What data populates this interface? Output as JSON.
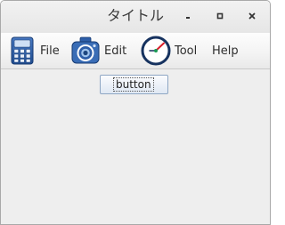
{
  "window": {
    "title": "タイトル"
  },
  "window_controls": {
    "minimize_icon": "minimize-icon",
    "maximize_icon": "maximize-icon",
    "close_icon": "close-icon"
  },
  "menubar": {
    "items": [
      {
        "label": "File",
        "icon": "calculator-icon"
      },
      {
        "label": "Edit",
        "icon": "camera-icon"
      },
      {
        "label": "Tool",
        "icon": "gauge-icon"
      },
      {
        "label": "Help",
        "icon": ""
      }
    ]
  },
  "main": {
    "button_label": "button"
  },
  "colors": {
    "window_background": "#eeeeee",
    "button_border": "#8ea6c3",
    "icon_blue": "#2d5ea8",
    "gauge_needle": "#d81e2a",
    "gauge_pivot": "#1a9a55"
  }
}
